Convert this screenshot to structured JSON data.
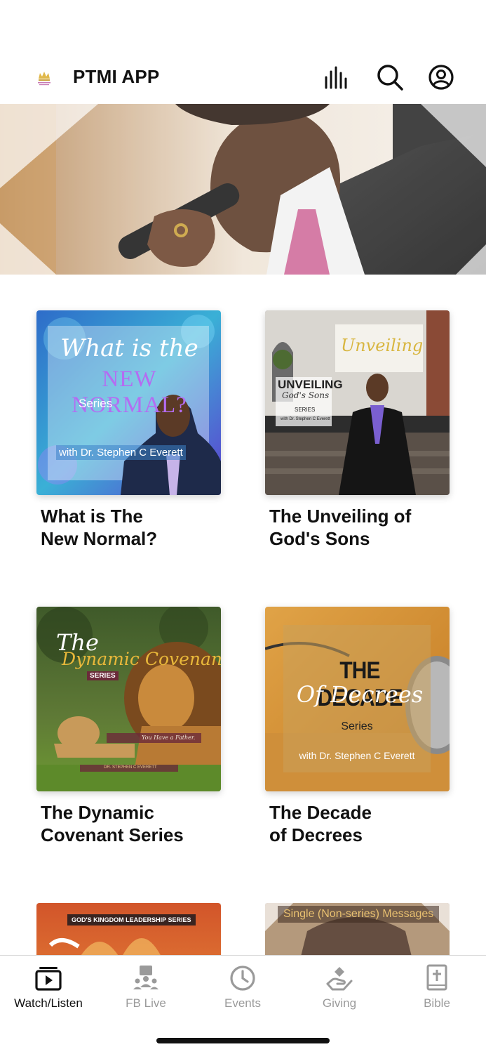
{
  "header": {
    "title": "PTMI APP",
    "logo_icon": "crown-logo-icon",
    "icons": [
      "audio-bars-icon",
      "search-icon",
      "account-icon"
    ]
  },
  "hero": {
    "image": "preacher-with-microphone"
  },
  "series": [
    {
      "title_line1": "What is The",
      "title_line2": "New Normal?",
      "art": {
        "script": "What is the",
        "headline": "NEW NORMAL?",
        "sub": "Series",
        "credit": "with Dr. Stephen C Everett"
      }
    },
    {
      "title_line1": "The Unveiling of",
      "title_line2": "God's Sons",
      "art": {
        "screen": "Unveiling",
        "headline": "UNVEILING",
        "script": "God's Sons",
        "sub": "SERIES",
        "credit": "with Dr. Stephen C Everett"
      }
    },
    {
      "title_line1": "The Dynamic",
      "title_line2": "Covenant Series",
      "art": {
        "script1": "The",
        "script2": "Dynamic Covenant",
        "sub": "SERIES",
        "tagline": "You Have a Father.",
        "credit": "DR. STEPHEN C EVERETT"
      }
    },
    {
      "title_line1": "The Decade",
      "title_line2": "of Decrees",
      "art": {
        "headline": "THE DECADE",
        "script": "Of Decrees",
        "sub": "Series",
        "credit": "with Dr. Stephen C Everett"
      }
    },
    {
      "art": {
        "badge": "GOD'S KINGDOM LEADERSHIP SERIES"
      }
    },
    {
      "art": {
        "badge": "Single (Non-series) Messages"
      }
    }
  ],
  "tabbar": {
    "active": "Watch/Listen",
    "tabs": [
      {
        "label": "Watch/Listen",
        "icon": "play-stack-icon"
      },
      {
        "label": "FB Live",
        "icon": "live-presenter-icon"
      },
      {
        "label": "Events",
        "icon": "clock-icon"
      },
      {
        "label": "Giving",
        "icon": "giving-hand-icon"
      },
      {
        "label": "Bible",
        "icon": "bible-icon"
      }
    ]
  },
  "colors": {
    "text": "#111111",
    "tab_inactive": "#9a9a9a",
    "divider": "#d9d9d9"
  }
}
